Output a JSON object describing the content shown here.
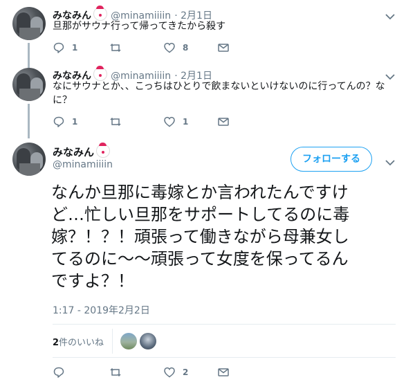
{
  "thread": [
    {
      "name": "みなみん",
      "handle": "@minamiiiin",
      "date": "· 2月1日",
      "text": "旦那がサウナ行って帰ってきたから殺す",
      "replies": "1",
      "retweets": "",
      "likes": "8"
    },
    {
      "name": "みなみん",
      "handle": "@minamiiiin",
      "date": "· 2月1日",
      "text_line1": "なにサウナとか、、こっちはひとりで飲まないといけないのに行ってんの？な",
      "text_line2": "に？",
      "replies": "1",
      "retweets": "",
      "likes": "1"
    }
  ],
  "main_tweet": {
    "name": "みなみん",
    "handle": "@minamiiiin",
    "follow_label": "フォローする",
    "lines": [
      "なんか旦那に毒嫁とか言われたんですけ",
      "ど…忙しい旦那をサポートしてるのに毒",
      "嫁？！？！頑張って働きながら母兼女し",
      "てるのに〜〜頑張って女度を保ってるん",
      "ですよ？！"
    ],
    "timestamp": "1:17 - 2019年2月2日",
    "likes_count": "2",
    "likes_suffix": "件のいいね",
    "replies": "",
    "retweets": "",
    "likes": "2"
  },
  "icons": [
    "reply-icon",
    "retweet-icon",
    "heart-icon",
    "message-icon",
    "chevron-down-icon",
    "clown-emoji-icon"
  ],
  "colors": {
    "accent": "#1da1f2",
    "muted": "#657786",
    "thread_line": "#aab8c2"
  }
}
